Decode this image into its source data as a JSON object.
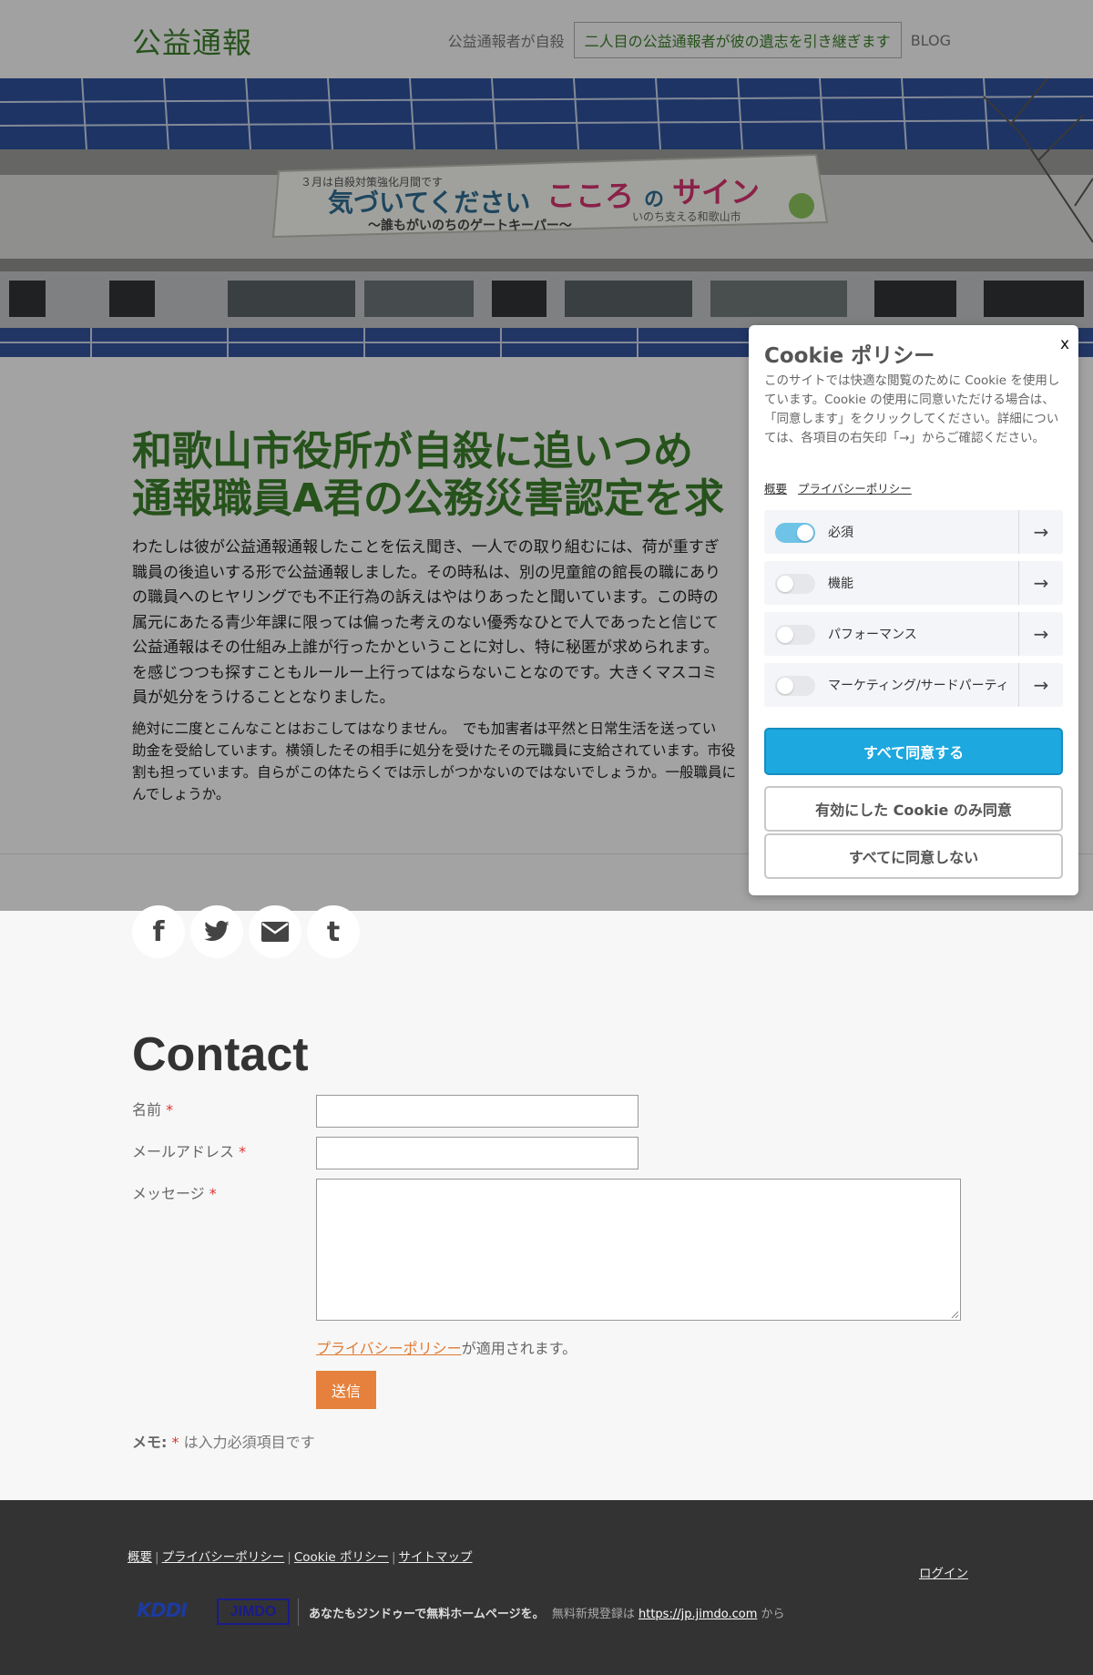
{
  "header": {
    "logo": "公益通報",
    "nav": [
      "公益通報者が自殺",
      "二人目の公益通報者が彼の遺志を引き継ぎます",
      "BLOG"
    ]
  },
  "hero": {
    "banner_small": "３月は自殺対策強化月間です",
    "banner_main_a": "気づいてください",
    "banner_main_b": "こころ",
    "banner_main_c": "の",
    "banner_main_d": "サイン",
    "banner_sub": "〜誰もがいのちのゲートキーパー〜",
    "banner_org": "いのち支える和歌山市"
  },
  "article": {
    "title_line1": "和歌山市役所が自殺に追いつめ",
    "title_line2": "通報職員A君の公務災害認定を求",
    "p1_lines": [
      "わたしは彼が公益通報通報したことを伝え聞き、一人での取り組むには、荷が重すぎ",
      "職員の後追いする形で公益通報しました。その時私は、別の児童館の館長の職にあり",
      "の職員へのヒヤリングでも不正行為の訴えはやはりあったと聞いています。この時の",
      "属元にあたる青少年課に限っては偏った考えのない優秀なひとで人であったと信じて",
      "公益通報はその仕組み上誰が行ったかということに対し、特に秘匿が求められます。",
      "を感じつつも探すこともルールー上行ってはならないことなのです。大きくマスコミ",
      "員が処分をうけることとなりました。"
    ],
    "p2_lines": [
      "絶対に二度とこんなことはおこしてはなりません。　でも加害者は平然と日常生活を送ってい",
      "助金を受給しています。横領したその相手に処分を受けたその元職員に支給されています。市役",
      "割も担っています。自らがこの体たらくでは示しがつかないのではないでしょうか。一般職員に",
      "んでしょうか。"
    ]
  },
  "share": {
    "icons": [
      "facebook-icon",
      "twitter-icon",
      "email-icon",
      "tumblr-icon"
    ]
  },
  "contact": {
    "title": "Contact",
    "name_label": "名前",
    "email_label": "メールアドレス",
    "message_label": "メッセージ",
    "required_mark": "*",
    "privacy_link": "プライバシーポリシー",
    "privacy_suffix": "が適用されます。",
    "submit": "送信",
    "memo_prefix": "メモ:",
    "memo_suffix": "は入力必須項目です"
  },
  "footer": {
    "links": [
      "概要",
      "プライバシーポリシー",
      "Cookie ポリシー",
      "サイトマップ"
    ],
    "separator": "|",
    "login": "ログイン",
    "kddi": "KDDI",
    "jimdo": "JIMDO",
    "promo_bold": "あなたもジンドゥーで無料ホームページを。",
    "promo_text": "無料新規登録は",
    "promo_link": "https://jp.jimdo.com",
    "promo_tail": "から"
  },
  "cookie": {
    "title": "Cookie ポリシー",
    "close": "x",
    "description": "このサイトでは快適な閲覧のために Cookie を使用しています。Cookie の使用に同意いただける場合は、「同意します」をクリックしてください。詳細については、各項目の右矢印「→」からご確認ください。",
    "links": [
      "概要",
      "プライバシーポリシー"
    ],
    "categories": [
      {
        "label": "必須",
        "enabled": true
      },
      {
        "label": "機能",
        "enabled": false
      },
      {
        "label": "パフォーマンス",
        "enabled": false
      },
      {
        "label": "マーケティング/サードパーティ",
        "enabled": false
      }
    ],
    "arrow": "→",
    "accept_all": "すべて同意する",
    "accept_selected": "有効にした Cookie のみ同意",
    "decline_all": "すべてに同意しない"
  },
  "colors": {
    "brand_green": "#3a7d2a",
    "accent_orange": "#e5813c",
    "cookie_blue": "#1da8df"
  }
}
